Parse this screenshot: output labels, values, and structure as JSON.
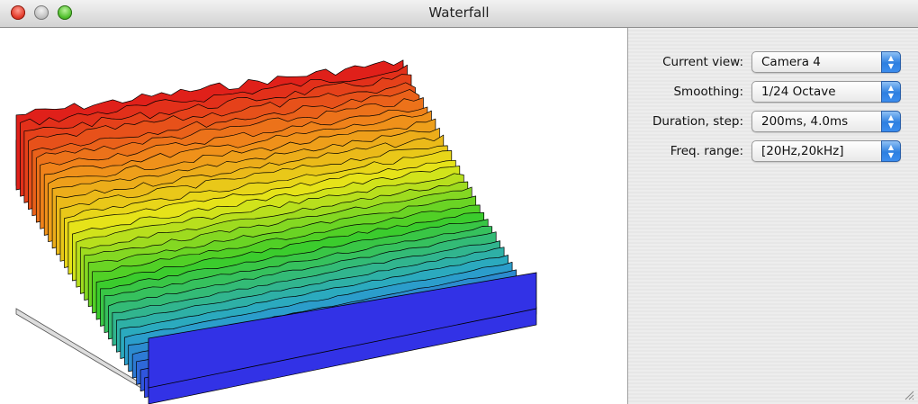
{
  "window": {
    "title": "Waterfall"
  },
  "controls": [
    {
      "label": "Current view:",
      "value": "Camera 4"
    },
    {
      "label": "Smoothing:",
      "value": "1/24 Octave"
    },
    {
      "label": "Duration, step:",
      "value": "200ms, 4.0ms"
    },
    {
      "label": "Freq. range:",
      "value": "[20Hz,20kHz]"
    }
  ],
  "plot": {
    "type": "3d-waterfall",
    "colors": [
      "#e0201a",
      "#f08c1a",
      "#e6e619",
      "#3ccd28",
      "#2aa8c8",
      "#3232e6"
    ]
  }
}
